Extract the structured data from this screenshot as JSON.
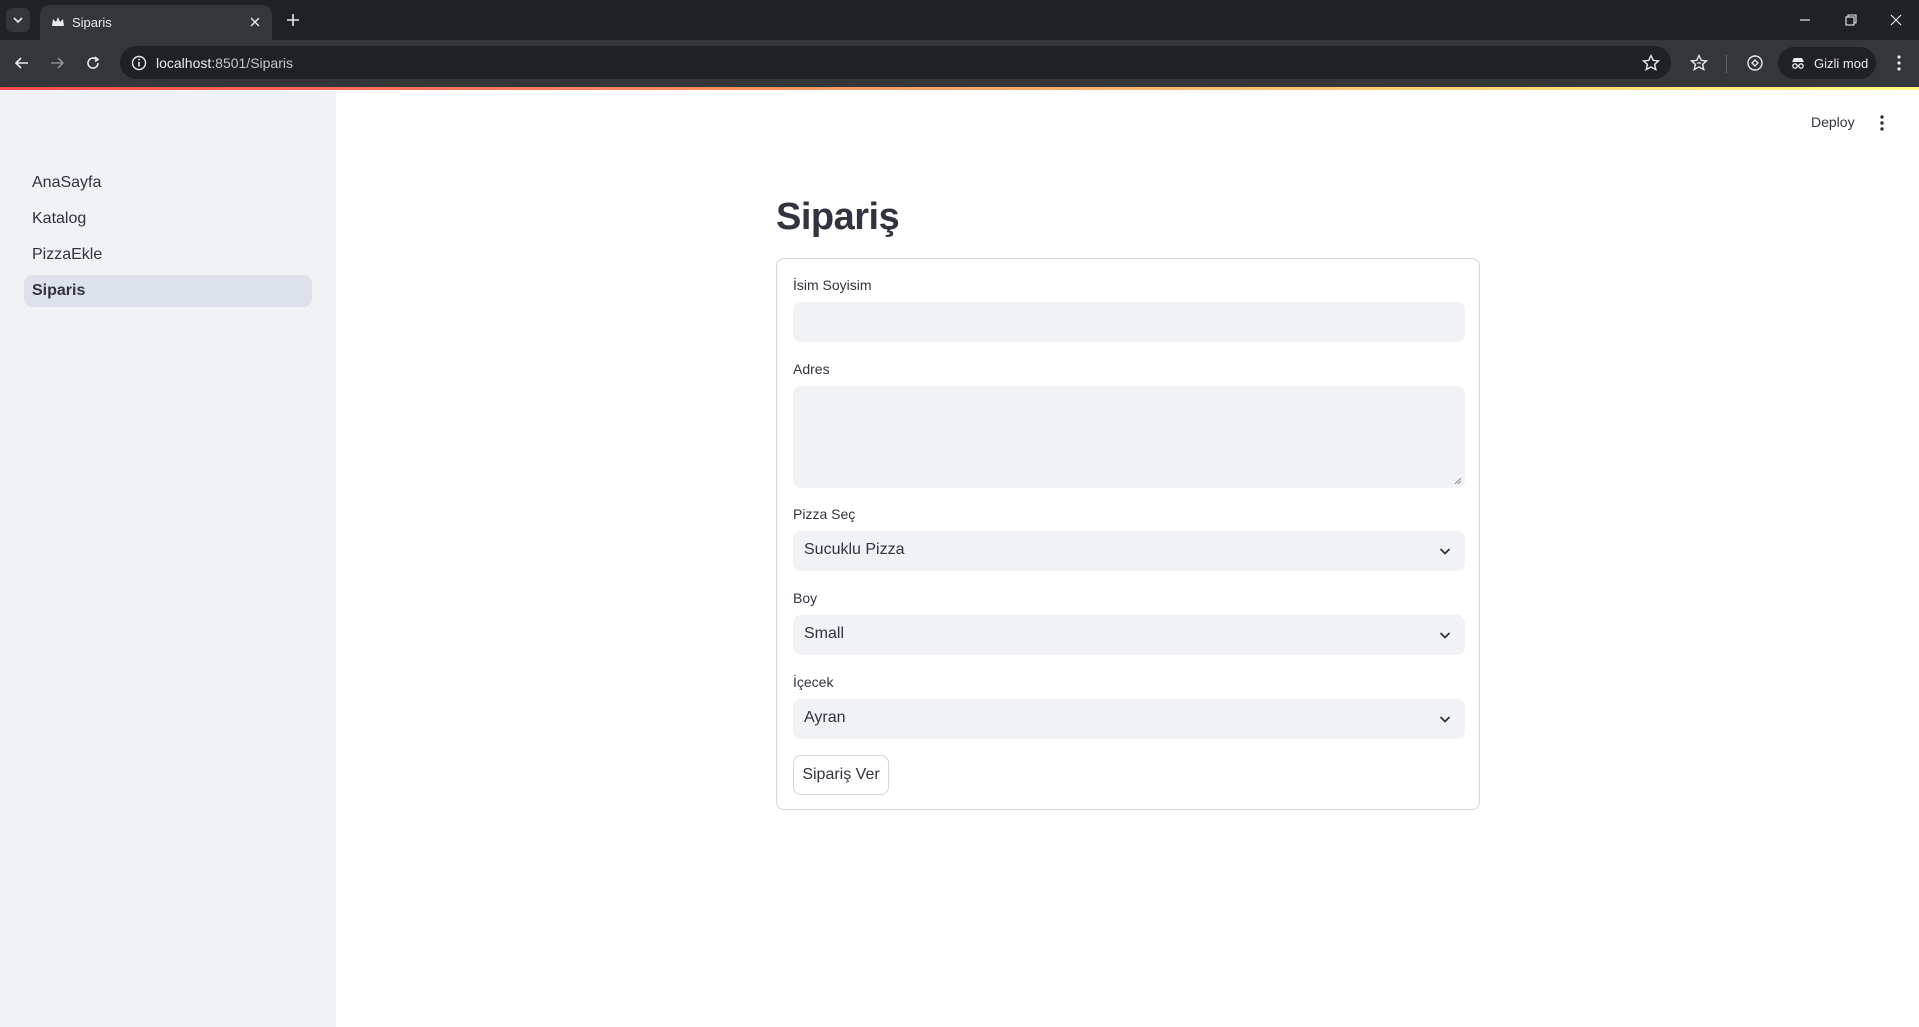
{
  "browser": {
    "tab_title": "Siparis",
    "url_host": "localhost",
    "url_rest": ":8501/Siparis",
    "incognito_label": "Gizli mod"
  },
  "sidebar": {
    "items": [
      {
        "label": "AnaSayfa",
        "active": false
      },
      {
        "label": "Katalog",
        "active": false
      },
      {
        "label": "PizzaEkle",
        "active": false
      },
      {
        "label": "Siparis",
        "active": true
      }
    ]
  },
  "header": {
    "deploy_label": "Deploy"
  },
  "main": {
    "title": "Sipariş",
    "form": {
      "name_label": "İsim Soyisim",
      "name_value": "",
      "address_label": "Adres",
      "address_value": "",
      "pizza_label": "Pizza Seç",
      "pizza_value": "Sucuklu Pizza",
      "size_label": "Boy",
      "size_value": "Small",
      "drink_label": "İçecek",
      "drink_value": "Ayran",
      "submit_label": "Sipariş Ver"
    }
  },
  "colors": {
    "accent_start": "#ff4b4b",
    "accent_end": "#fffd80",
    "sidebar_bg": "#f0f2f6",
    "text": "#31333f"
  }
}
